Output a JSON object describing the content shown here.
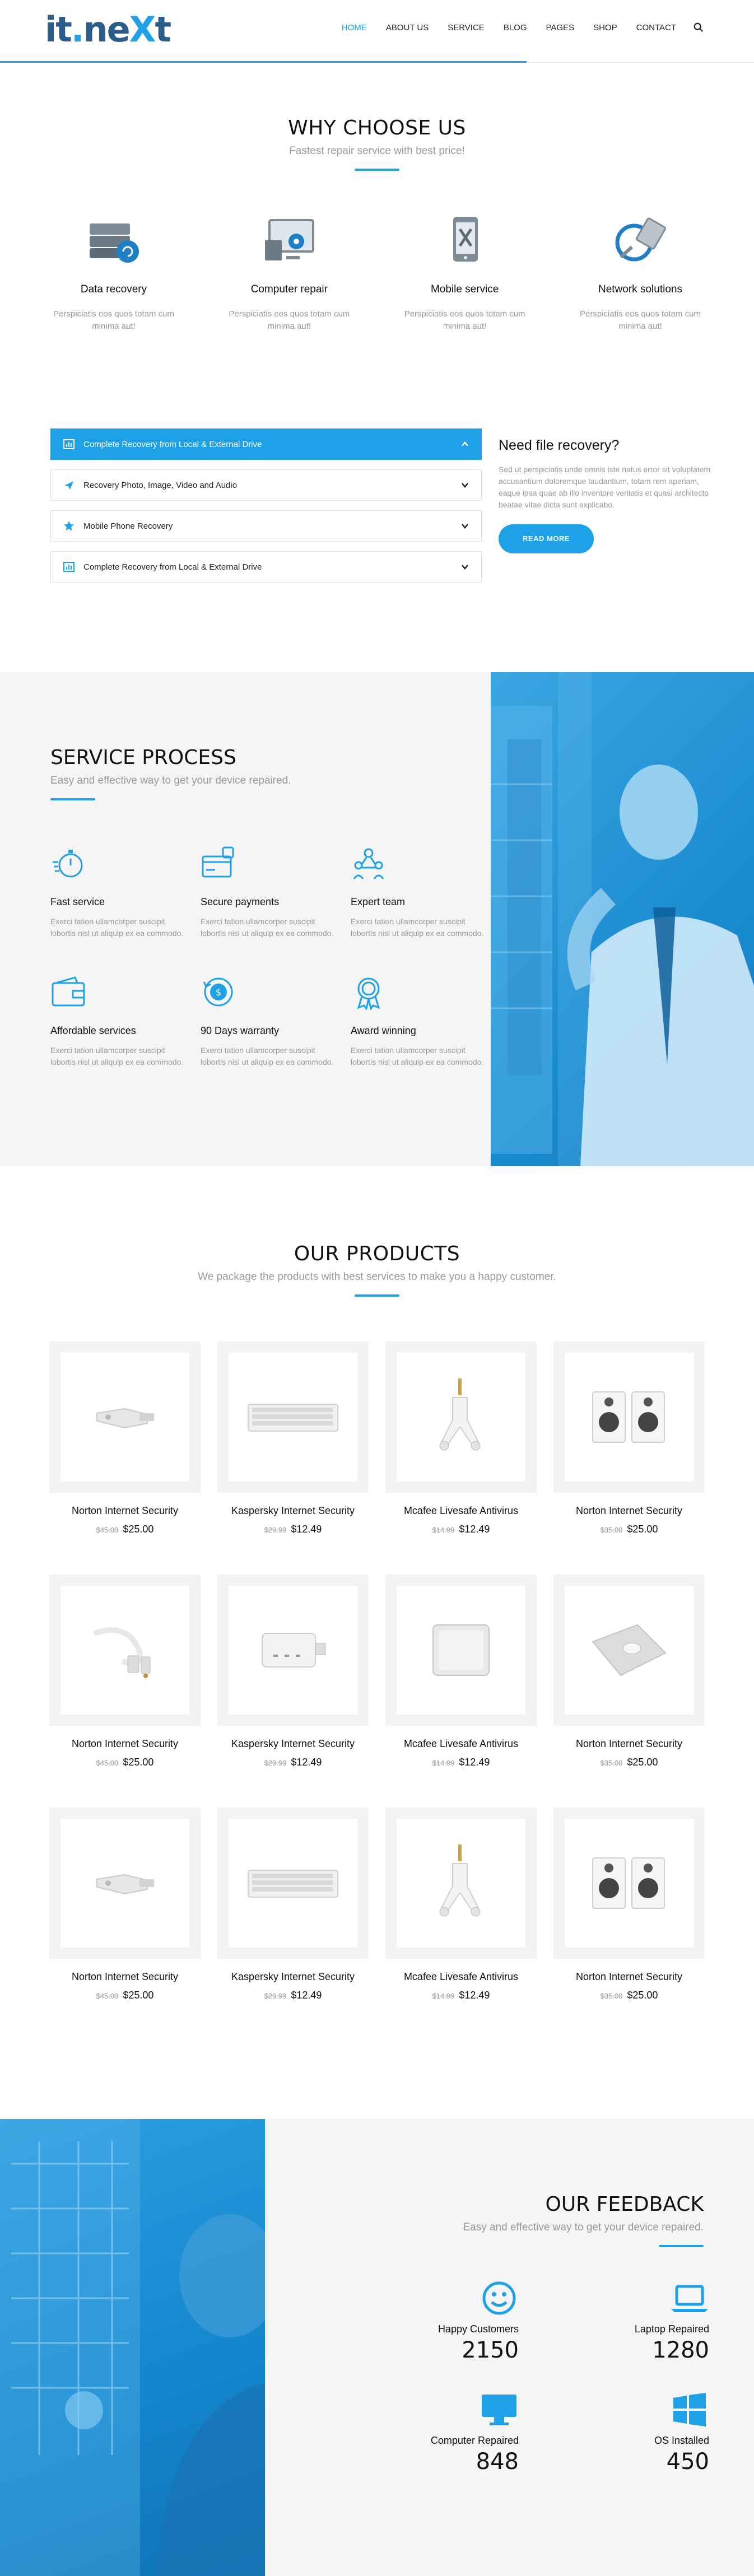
{
  "brand": {
    "logo_a": "it",
    "logo_dot": ".",
    "logo_b": "ne",
    "logo_x": "X",
    "logo_c": "t",
    "accent": "#1ea1e6"
  },
  "nav": [
    {
      "label": "HOME",
      "active": true
    },
    {
      "label": "ABOUT US"
    },
    {
      "label": "SERVICE"
    },
    {
      "label": "BLOG"
    },
    {
      "label": "PAGES"
    },
    {
      "label": "SHOP"
    },
    {
      "label": "CONTACT"
    }
  ],
  "why": {
    "title": "WHY CHOOSE US",
    "subtitle": "Fastest repair service with best price!",
    "features": [
      {
        "icon": "data-recovery-icon",
        "title": "Data recovery",
        "text": "Perspiciatis eos quos totam cum minima aut!"
      },
      {
        "icon": "computer-repair-icon",
        "title": "Computer repair",
        "text": "Perspiciatis eos quos totam cum minima aut!"
      },
      {
        "icon": "mobile-service-icon",
        "title": "Mobile service",
        "text": "Perspiciatis eos quos totam cum minima aut!"
      },
      {
        "icon": "network-solutions-icon",
        "title": "Network solutions",
        "text": "Perspiciatis eos quos totam cum minima aut!"
      }
    ],
    "accordion": [
      {
        "icon": "bar-chart-icon",
        "label": "Complete Recovery from Local & External Drive",
        "active": true
      },
      {
        "icon": "plane-icon",
        "label": "Recovery Photo, Image, Video and Audio"
      },
      {
        "icon": "star-icon",
        "label": "Mobile Phone Recovery"
      },
      {
        "icon": "bar-chart-icon",
        "label": "Complete Recovery from Local & External Drive"
      }
    ],
    "need": {
      "title": "Need file recovery?",
      "text": "Sed ut perspiciatis unde omnis iste natus error sit voluptatem accusantium doloremque laudantium, totam rem aperiam, eaque ipsa quae ab illo inventore veritatis et quasi architecto beatae vitae dicta sunt explicabo.",
      "button": "READ MORE"
    }
  },
  "process": {
    "title": "SERVICE PROCESS",
    "subtitle": "Easy and effective way to get your device repaired.",
    "items": [
      {
        "icon": "stopwatch-icon",
        "title": "Fast service",
        "text": "Exerci tation ullamcorper suscipit lobortis nisl ut aliquip ex ea commodo."
      },
      {
        "icon": "payment-icon",
        "title": "Secure payments",
        "text": "Exerci tation ullamcorper suscipit lobortis nisl ut aliquip ex ea commodo."
      },
      {
        "icon": "team-icon",
        "title": "Expert team",
        "text": "Exerci tation ullamcorper suscipit lobortis nisl ut aliquip ex ea commodo."
      },
      {
        "icon": "wallet-icon",
        "title": "Affordable services",
        "text": "Exerci tation ullamcorper suscipit lobortis nisl ut aliquip ex ea commodo."
      },
      {
        "icon": "warranty-icon",
        "title": "90 Days warranty",
        "text": "Exerci tation ullamcorper suscipit lobortis nisl ut aliquip ex ea commodo."
      },
      {
        "icon": "award-icon",
        "title": "Award winning",
        "text": "Exerci tation ullamcorper suscipit lobortis nisl ut aliquip ex ea commodo."
      }
    ]
  },
  "products": {
    "title": "OUR PRODUCTS",
    "subtitle": "We package the products with best services to make you a happy customer.",
    "items": [
      {
        "image": "usb-drive",
        "name": "Norton Internet Security",
        "old_price": "$45.00",
        "price": "$25.00"
      },
      {
        "image": "keyboard",
        "name": "Kaspersky Internet Security",
        "old_price": "$29.99",
        "price": "$12.49"
      },
      {
        "image": "audio-splitter",
        "name": "Mcafee Livesafe Antivirus",
        "old_price": "$14.99",
        "price": "$12.49"
      },
      {
        "image": "speakers",
        "name": "Norton Internet Security",
        "old_price": "$35.00",
        "price": "$25.00"
      },
      {
        "image": "cable",
        "name": "Norton Internet Security",
        "old_price": "$45.00",
        "price": "$25.00"
      },
      {
        "image": "power-adapter",
        "name": "Kaspersky Internet Security",
        "old_price": "$29.99",
        "price": "$12.49"
      },
      {
        "image": "hard-drive",
        "name": "Mcafee Livesafe Antivirus",
        "old_price": "$14.99",
        "price": "$12.49"
      },
      {
        "image": "mouse-pad",
        "name": "Norton Internet Security",
        "old_price": "$35.00",
        "price": "$25.00"
      },
      {
        "image": "usb-drive",
        "name": "Norton Internet Security",
        "old_price": "$45.00",
        "price": "$25.00"
      },
      {
        "image": "keyboard",
        "name": "Kaspersky Internet Security",
        "old_price": "$29.99",
        "price": "$12.49"
      },
      {
        "image": "audio-splitter",
        "name": "Mcafee Livesafe Antivirus",
        "old_price": "$14.99",
        "price": "$12.49"
      },
      {
        "image": "speakers",
        "name": "Norton Internet Security",
        "old_price": "$35.00",
        "price": "$25.00"
      }
    ]
  },
  "feedback": {
    "title": "OUR FEEDBACK",
    "subtitle": "Easy and effective way to get your device repaired.",
    "stats": [
      {
        "icon": "smiley-icon",
        "label": "Happy Customers",
        "value": "2150"
      },
      {
        "icon": "laptop-icon",
        "label": "Laptop Repaired",
        "value": "1280"
      },
      {
        "icon": "monitor-icon",
        "label": "Computer Repaired",
        "value": "848"
      },
      {
        "icon": "windows-icon",
        "label": "OS Installed",
        "value": "450"
      }
    ]
  }
}
